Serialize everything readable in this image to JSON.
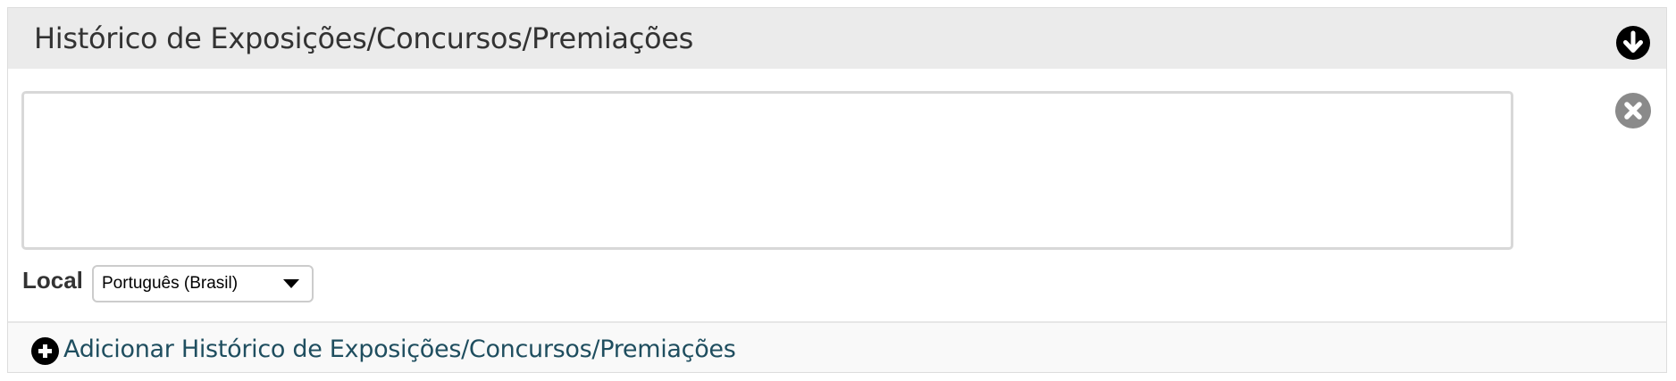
{
  "section": {
    "title": "Histórico de Exposições/Concursos/Premiações",
    "collapse_icon": "arrow-down-circle-icon",
    "remove_icon": "close-circle-icon"
  },
  "entry": {
    "text_value": "",
    "locale_label": "Local",
    "locale_selected": "Português (Brasil)"
  },
  "footer": {
    "add_icon": "plus-circle-icon",
    "add_label": "Adicionar Histórico de Exposições/Concursos/Premiações"
  },
  "colors": {
    "header_bg": "#ebebeb",
    "link_color": "#1f4e5f",
    "remove_icon_color": "#8a8a8a"
  }
}
